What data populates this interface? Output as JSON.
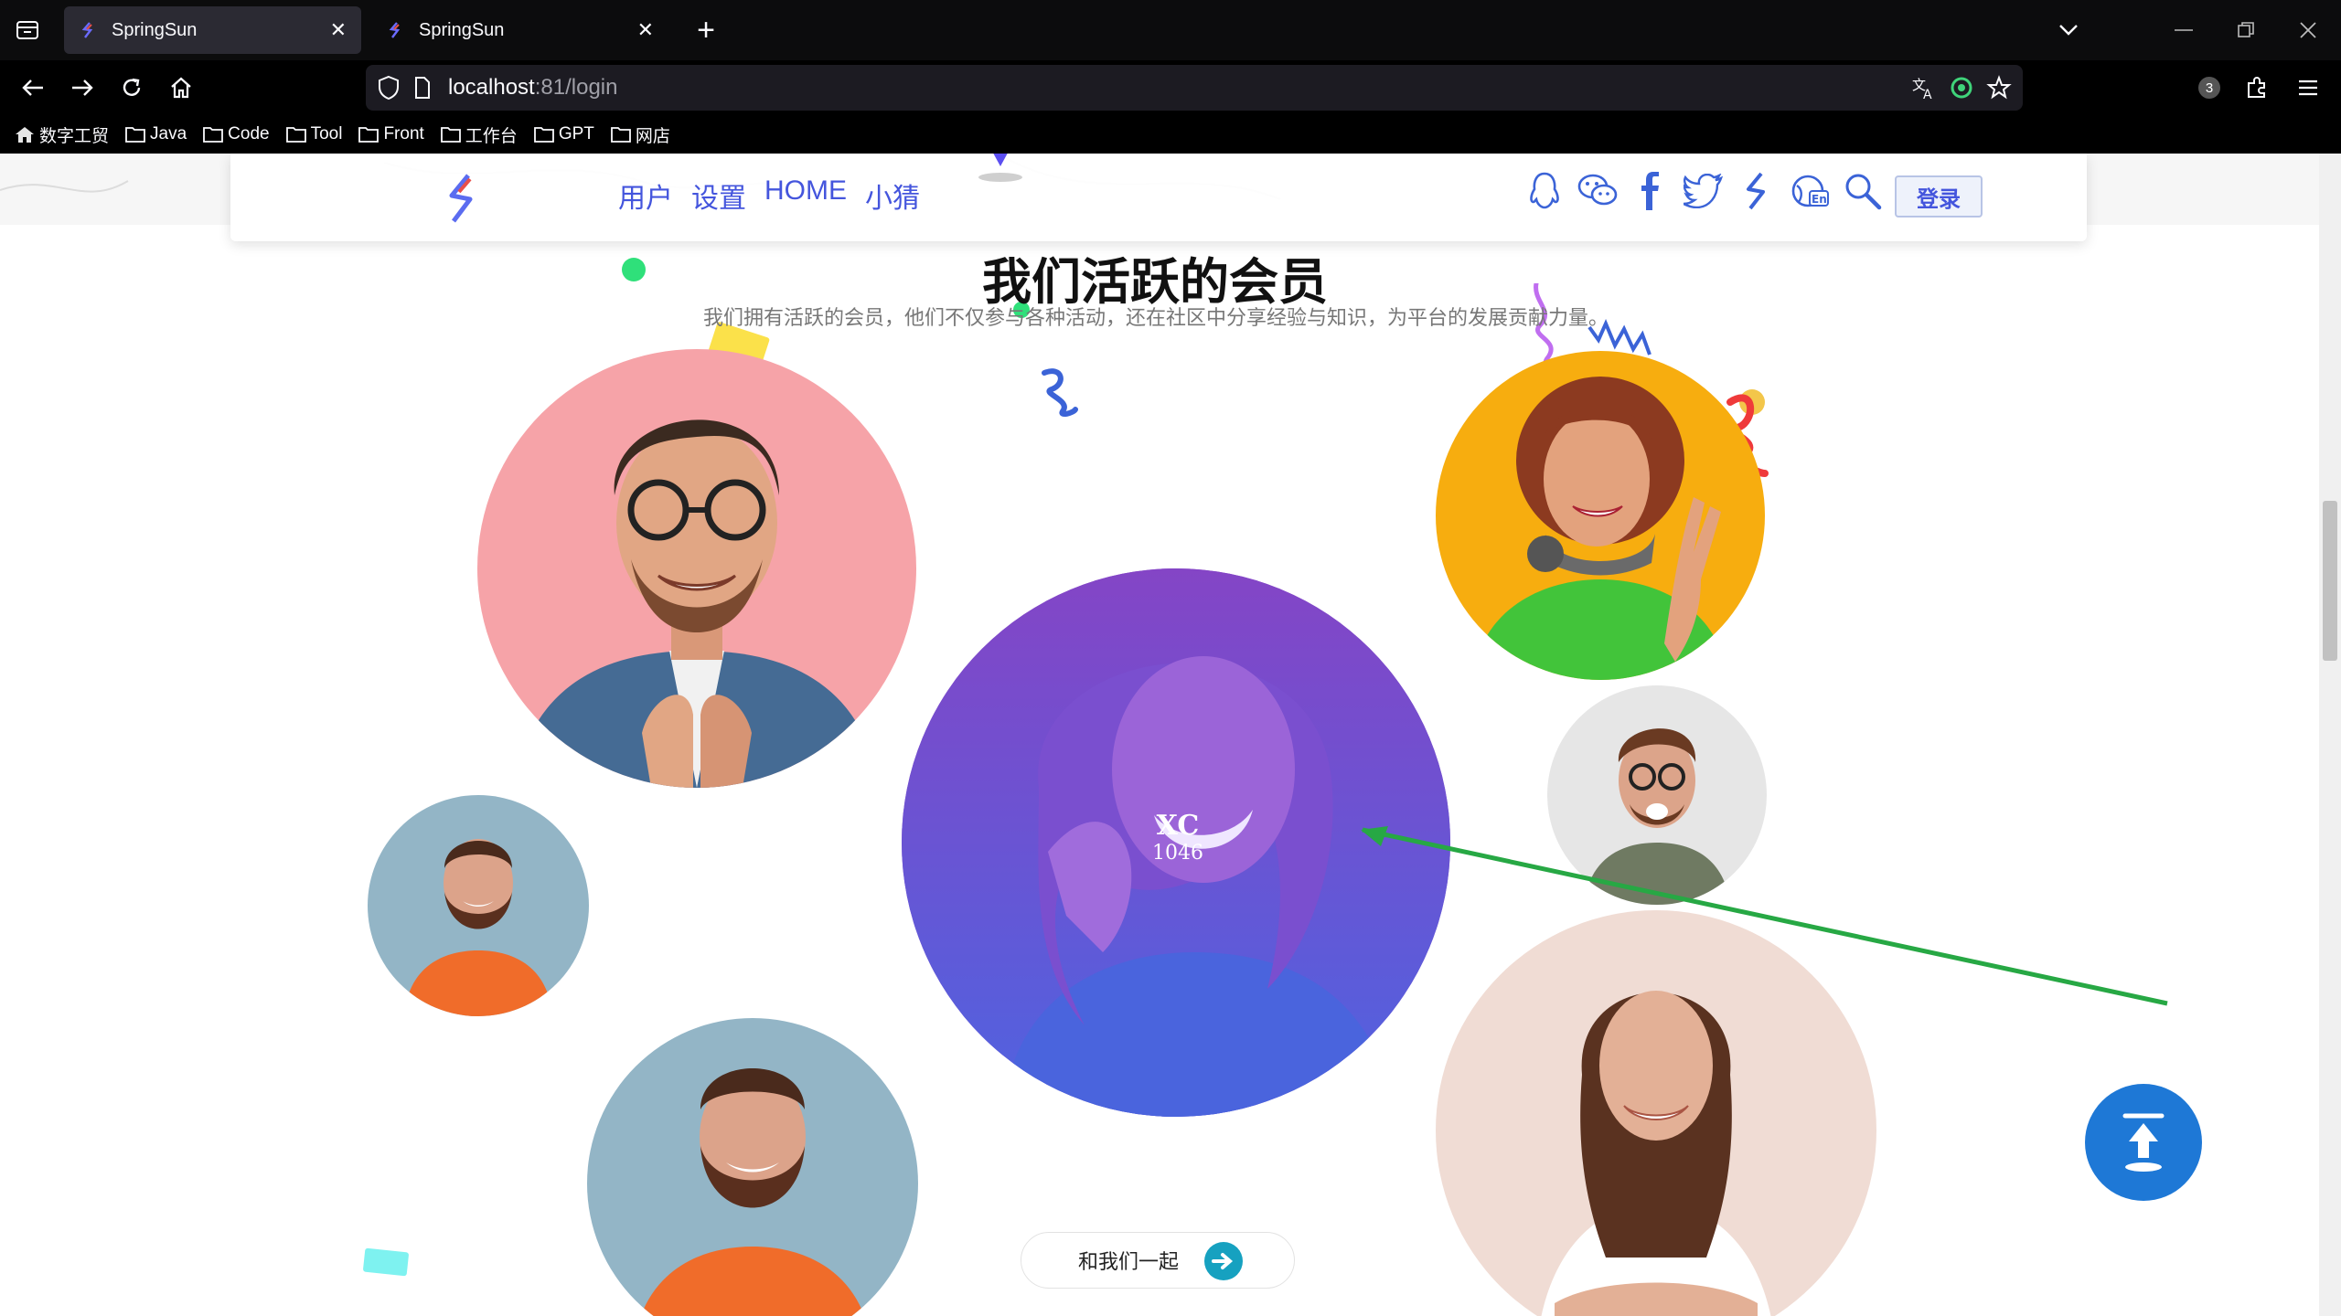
{
  "browser": {
    "tabs": [
      {
        "title": "SpringSun",
        "active": true
      },
      {
        "title": "SpringSun",
        "active": false
      }
    ],
    "url_host": "localhost",
    "url_port_path": ":81/login",
    "extension_badge": "3",
    "bookmarks": [
      {
        "label": "数字工贸",
        "icon": "home-icon"
      },
      {
        "label": "Java",
        "icon": "folder-icon"
      },
      {
        "label": "Code",
        "icon": "folder-icon"
      },
      {
        "label": "Tool",
        "icon": "folder-icon"
      },
      {
        "label": "Front",
        "icon": "folder-icon"
      },
      {
        "label": "工作台",
        "icon": "folder-icon"
      },
      {
        "label": "GPT",
        "icon": "folder-icon"
      },
      {
        "label": "网店",
        "icon": "folder-icon"
      }
    ]
  },
  "site": {
    "nav": [
      "用户",
      "设置",
      "HOME",
      "小猜"
    ],
    "social_icons": [
      "qq-icon",
      "wechat-icon",
      "facebook-icon",
      "twitter-icon",
      "brand-logo-icon",
      "language-en-icon",
      "search-icon"
    ],
    "login_label": "登录",
    "accent_color": "#4455dd"
  },
  "members_section": {
    "title": "我们活跃的会员",
    "subtitle": "我们拥有活跃的会员，他们不仅参与各种活动，还在社区中分享经验与知识，为平台的发展贡献力量。",
    "featured": {
      "name": "XC",
      "count": "1046"
    },
    "join_label": "和我们一起"
  }
}
